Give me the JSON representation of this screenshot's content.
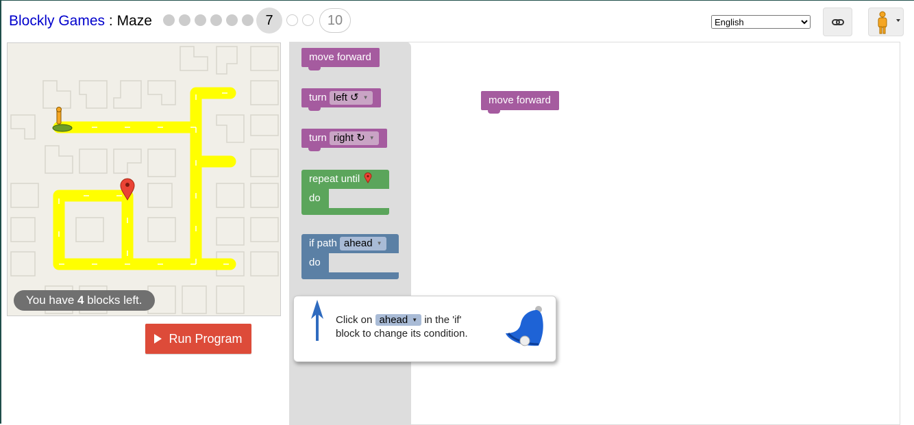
{
  "header": {
    "app_name": "Blockly Games",
    "separator": " : ",
    "game_name": "Maze",
    "current_level": "7",
    "last_level": "10",
    "language": "English",
    "language_options": [
      "English"
    ]
  },
  "icons": {
    "link": "link-icon",
    "pegman": "pegman-icon",
    "bell": "bell-icon",
    "hint_arrow": "up-arrow-icon",
    "start": "pegman-start-icon",
    "goal": "map-marker-icon"
  },
  "maze": {
    "blocks_left_prefix": "You have ",
    "blocks_left_count": "4",
    "blocks_left_suffix": " blocks left."
  },
  "run_button": "Run Program",
  "toolbox": {
    "move_forward": "move forward",
    "turn_left_label": "turn",
    "turn_left_value": "left ↺",
    "turn_right_label": "turn",
    "turn_right_value": "right ↻",
    "repeat_label": "repeat until",
    "repeat_do": "do",
    "if_label": "if path",
    "if_value": "ahead",
    "if_do": "do"
  },
  "workspace": {
    "placed_block": "move forward"
  },
  "hint": {
    "before": "Click on ",
    "dropdown": "ahead",
    "after_line1": " in the 'if'",
    "line2": "block to change its condition."
  },
  "colors": {
    "move": "#a55b9f",
    "loop": "#5ba55b",
    "logic": "#5b80a5",
    "path": "#ffff00",
    "run": "#dd4b39"
  }
}
